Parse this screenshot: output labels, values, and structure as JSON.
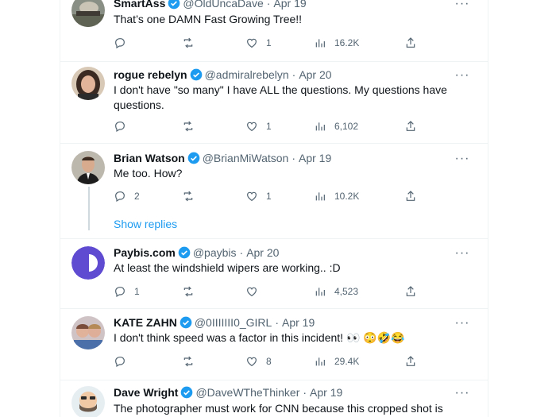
{
  "tweets": [
    {
      "name": "SmartAss",
      "handle": "@OldUncaDave",
      "date": "Apr 19",
      "text": "That’s one DAMN Fast Growing Tree!!",
      "replies": "",
      "retweets": "",
      "likes": "1",
      "views": "16.2K"
    },
    {
      "name": "rogue rebelyn",
      "handle": "@admiralrebelyn",
      "date": "Apr 20",
      "text": "I don't have \"so many\" I have ALL the questions. My questions have questions.",
      "replies": "",
      "retweets": "",
      "likes": "1",
      "views": "6,102"
    },
    {
      "name": "Brian Watson",
      "handle": "@BrianMiWatson",
      "date": "Apr 19",
      "text": "Me too. How?",
      "replies": "2",
      "retweets": "",
      "likes": "1",
      "views": "10.2K",
      "show_replies": "Show replies"
    },
    {
      "name": "Paybis.com",
      "handle": "@paybis",
      "date": "Apr 20",
      "text": "At least the windshield wipers are working.. :D",
      "replies": "1",
      "retweets": "",
      "likes": "",
      "views": "4,523"
    },
    {
      "name": "KATE ZAHN",
      "handle": "@0IIIIIII0_GIRL",
      "date": "Apr 19",
      "text": "I don't think speed was a factor in this incident! 👀 😳🤣😂",
      "replies": "",
      "retweets": "",
      "likes": "8",
      "views": "29.4K"
    },
    {
      "name": "Dave Wright",
      "handle": "@DaveWTheThinker",
      "date": "Apr 19",
      "text": "The photographer must work for CNN because this cropped shot is very"
    }
  ],
  "ui": {
    "dot": "·",
    "more": "···"
  },
  "colors": {
    "verified": "#1d9bf0",
    "link": "#1d9bf0",
    "muted": "#536471",
    "paybis_avatar": "#5f4bd1"
  }
}
